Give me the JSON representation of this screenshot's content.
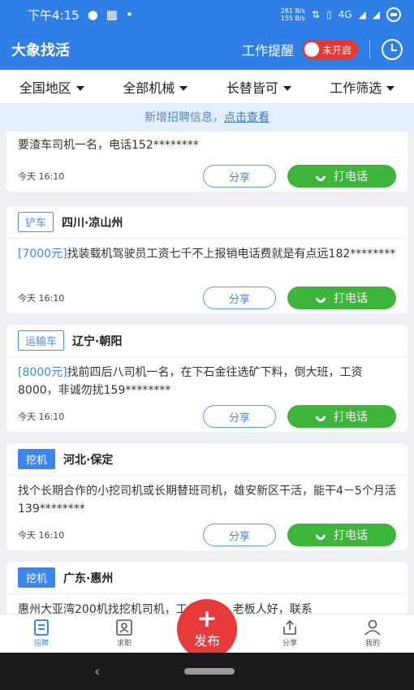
{
  "status": {
    "time": "下午4:15",
    "net_speed_top": "261 B/s",
    "net_speed_bottom": "155 B/s",
    "network": "4G"
  },
  "appbar": {
    "title": "大象找活",
    "reminder_label": "工作提醒",
    "toggle_label": "未开启"
  },
  "filters": [
    "全国地区",
    "全部机械",
    "长替皆可",
    "工作筛选"
  ],
  "notice": {
    "text": "新增招聘信息，",
    "link": "点击查看"
  },
  "cards": [
    {
      "desc": "要渣车司机一名，电话152********",
      "time": "今天 16:10",
      "share": "分享",
      "call": "打电话"
    },
    {
      "tag": "铲车",
      "location": "四川·凉山州",
      "price": "[7000元]",
      "desc": "找装载机驾驶员工资七千不上报销电话费就是有点远182********",
      "time": "今天 16:10",
      "share": "分享",
      "call": "打电话"
    },
    {
      "tag": "运输车",
      "location": "辽宁·朝阳",
      "price": "[8000元]",
      "desc": "找前四后八司机一名，在下石金往选矿下料，倒大班，工资8000，非诚勿扰159********",
      "time": "今天 16:10",
      "share": "分享",
      "call": "打电话"
    },
    {
      "tag": "挖机",
      "location": "河北·保定",
      "desc": "找个长期合作的小挖司机或长期替班司机，雄安新区干活，能干4－5个月活139********",
      "time": "今天 16:10",
      "share": "分享",
      "call": "打电话"
    },
    {
      "tag": "挖机",
      "location": "广东·惠州",
      "desc": "惠州大亚湾200机找挖机司机，工作轻松，老板人好，联系"
    }
  ],
  "tabbar": [
    {
      "label": "招聘",
      "icon": "document-list-icon"
    },
    {
      "label": "求职",
      "icon": "person-card-icon"
    },
    {
      "label": "分享",
      "icon": "share-icon"
    },
    {
      "label": "我的",
      "icon": "user-icon"
    }
  ],
  "publish": {
    "label": "发布"
  },
  "colors": {
    "primary": "#2f7fe6",
    "call_green": "#3cb53a",
    "publish_red": "#e73b3b",
    "toggle_red": "#e53935"
  }
}
